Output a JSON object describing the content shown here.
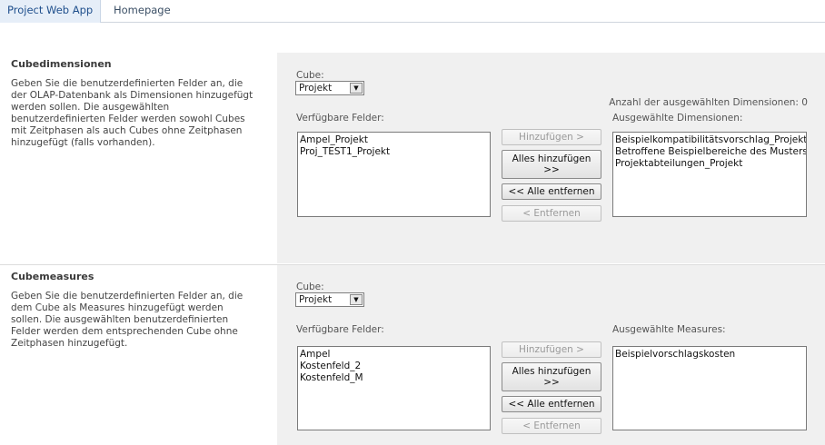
{
  "nav": {
    "tabs": [
      "Project Web App",
      "Homepage"
    ]
  },
  "dimensions": {
    "title": "Cubedimensionen",
    "description": "Geben Sie die benutzerdefinierten Felder an, die der OLAP-Datenbank als Dimensionen hinzugefügt werden sollen. Die ausgewählten benutzerdefinierten Felder werden sowohl Cubes mit Zeitphasen als auch Cubes ohne Zeitphasen hinzugefügt (falls vorhanden).",
    "cube_label": "Cube:",
    "cube_value": "Projekt",
    "count_label": "Anzahl der ausgewählten Dimensionen: 0",
    "available_label": "Verfügbare Felder:",
    "available": [
      "Ampel_Projekt",
      "Proj_TEST1_Projekt"
    ],
    "selected_label": "Ausgewählte Dimensionen:",
    "selected": [
      "Beispielkompatibilitätsvorschlag_Projekt",
      "Betroffene Beispielbereiche des Musters_Projekt",
      "Projektabteilungen_Projekt"
    ],
    "buttons": {
      "add": "Hinzufügen >",
      "add_all": "Alles hinzufügen >>",
      "remove_all": "<< Alle entfernen",
      "remove": "< Entfernen"
    }
  },
  "measures": {
    "title": "Cubemeasures",
    "description": "Geben Sie die benutzerdefinierten Felder an, die dem Cube als Measures hinzugefügt werden sollen. Die ausgewählten benutzerdefinierten Felder werden dem entsprechenden Cube ohne Zeitphasen hinzugefügt.",
    "cube_label": "Cube:",
    "cube_value": "Projekt",
    "available_label": "Verfügbare Felder:",
    "available": [
      "Ampel",
      "Kostenfeld_2",
      "Kostenfeld_M"
    ],
    "selected_label": "Ausgewählte Measures:",
    "selected": [
      "Beispielvorschlagskosten"
    ],
    "buttons": {
      "add": "Hinzufügen >",
      "add_all": "Alles hinzufügen >>",
      "remove_all": "<< Alle entfernen",
      "remove": "< Entfernen"
    }
  },
  "icons": {
    "dropdown": "chevron-down-icon"
  }
}
